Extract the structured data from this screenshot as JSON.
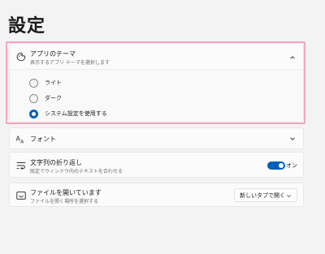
{
  "page": {
    "title": "設定"
  },
  "theme_section": {
    "title": "アプリのテーマ",
    "subtitle": "表示するアプリ テーマを選択します",
    "icon": "paint-icon",
    "expanded": true,
    "options": [
      {
        "label": "ライト",
        "selected": false
      },
      {
        "label": "ダーク",
        "selected": false
      },
      {
        "label": "システム設定を使用する",
        "selected": true
      }
    ]
  },
  "font_section": {
    "title": "フォント",
    "icon": "font-icon"
  },
  "wrap_section": {
    "title": "文字列の折り返し",
    "subtitle": "既定でウィンドウ内のテキストを合わせる",
    "icon": "wrap-icon",
    "toggle_state": "オン",
    "toggle_on": true
  },
  "open_file_section": {
    "title": "ファイルを開いています",
    "subtitle": "ファイルを開く場所を選択する",
    "icon": "open-file-icon",
    "dropdown_value": "新しいタブで開く"
  },
  "colors": {
    "accent": "#005fb8",
    "highlight_border": "#f2a6c2"
  }
}
